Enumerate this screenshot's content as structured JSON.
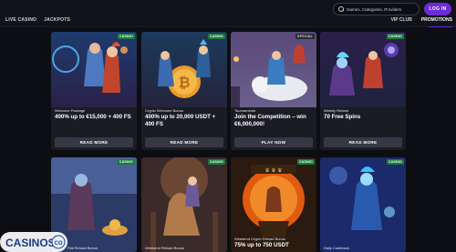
{
  "nav": {
    "live_casino": "LIVE CASINO",
    "jackpots": "JACKPOTS"
  },
  "search": {
    "placeholder": "Games, Categories, Providers"
  },
  "login_label": "LOG IN",
  "right_nav": {
    "vip_club": "VIP CLUB",
    "promotions": "PROMOTIONS"
  },
  "cards": [
    {
      "badge": "CASINO",
      "category": "Welcome Package",
      "title": "400% up to €15,000 + 400 FS",
      "cta": "READ MORE"
    },
    {
      "badge": "CASINO",
      "category": "Crypto Welcome Bonus",
      "title": "400% up to 20,000 USDT + 400 FS",
      "cta": "READ MORE"
    },
    {
      "badge": "SPECIAL",
      "category": "Tournaments",
      "title": "Join the Competition – win €6,000,000!",
      "cta": "PLAY NOW"
    },
    {
      "badge": "CASINO",
      "category": "Weekly Reload",
      "title": "70 Free Spins",
      "cta": "READ MORE"
    },
    {
      "badge": "CASINO",
      "category": "Fiat Reload Bonus",
      "title": "",
      "cta": ""
    },
    {
      "badge": "CASINO",
      "category": "Weekend Reload Bonus",
      "title": "",
      "cta": ""
    },
    {
      "badge": "CASINO",
      "category": "Weekend Crypto Reload Bonus",
      "title": "75% up to 750 USDT",
      "cta": ""
    },
    {
      "badge": "CASINO",
      "category": "Daily Cashback",
      "title": "",
      "cta": ""
    }
  ],
  "watermark": {
    "text": "CASINOS",
    "suffix": "CO"
  },
  "colors": {
    "accent": "#6b2bd9",
    "badge_green": "#1a7a3d",
    "card_bg": "#1b1c23",
    "page_bg": "#0d0e13"
  }
}
